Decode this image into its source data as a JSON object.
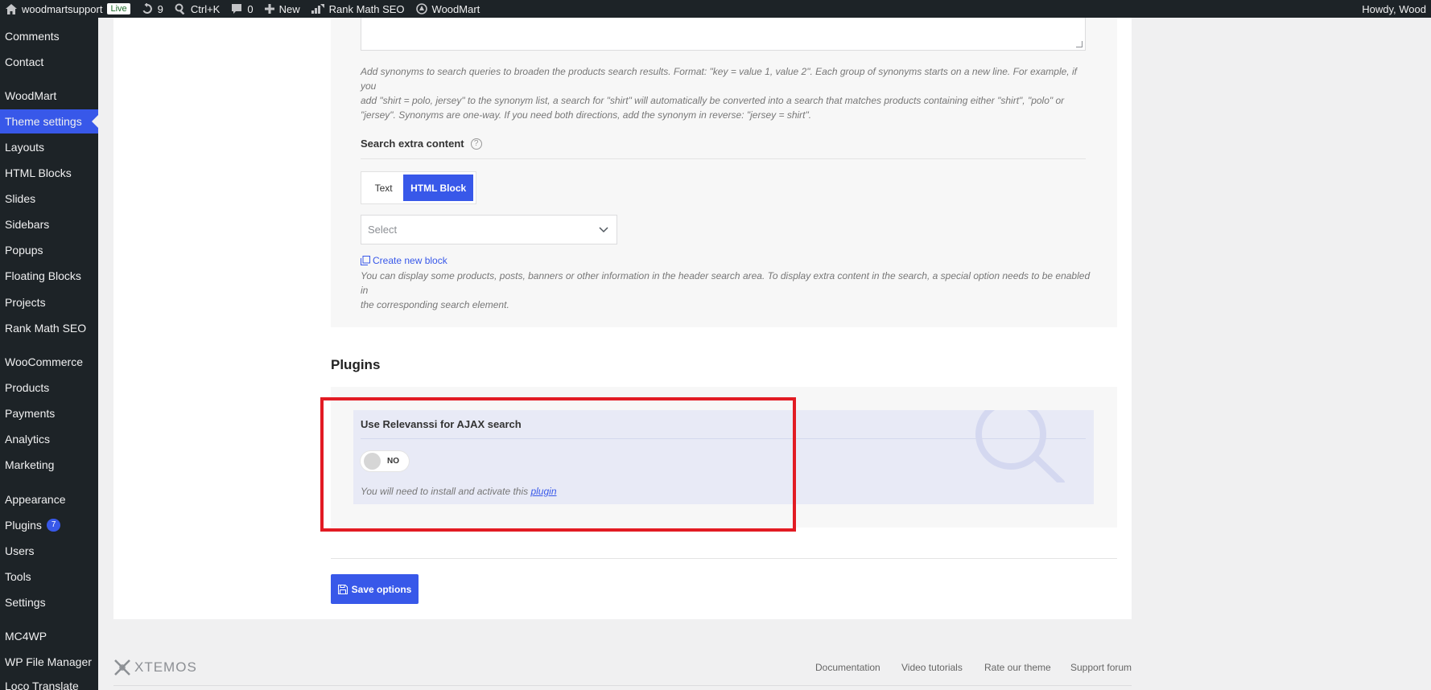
{
  "adminbar": {
    "site_name": "woodmartsupport",
    "live_badge": "Live",
    "updates_count": "9",
    "search_shortcut": "Ctrl+K",
    "comments_count": "0",
    "new_label": "New",
    "rankmath_label": "Rank Math SEO",
    "woodmart_label": "WoodMart",
    "howdy": "Howdy, Wood"
  },
  "sidebar": {
    "items": [
      {
        "label": "Comments"
      },
      {
        "label": "Contact"
      },
      {
        "label": "WoodMart"
      },
      {
        "label": "Theme settings"
      },
      {
        "label": "Layouts"
      },
      {
        "label": "HTML Blocks"
      },
      {
        "label": "Slides"
      },
      {
        "label": "Sidebars"
      },
      {
        "label": "Popups"
      },
      {
        "label": "Floating Blocks"
      },
      {
        "label": "Projects"
      },
      {
        "label": "Rank Math SEO"
      },
      {
        "label": "WooCommerce"
      },
      {
        "label": "Products"
      },
      {
        "label": "Payments"
      },
      {
        "label": "Analytics"
      },
      {
        "label": "Marketing"
      },
      {
        "label": "Appearance"
      },
      {
        "label": "Plugins",
        "badge": "7"
      },
      {
        "label": "Users"
      },
      {
        "label": "Tools"
      },
      {
        "label": "Settings"
      },
      {
        "label": "MC4WP"
      },
      {
        "label": "WP File Manager"
      },
      {
        "label": "Loco Translate"
      }
    ]
  },
  "synonyms": {
    "description_line1": "Add synonyms to search queries to broaden the products search results. Format: \"key = value 1, value 2\". Each group of synonyms starts on a new line. For example, if you",
    "description_line2": "add \"shirt = polo, jersey\" to the synonym list, a search for \"shirt\" will automatically be converted into a search that matches products containing either \"shirt\", \"polo\" or",
    "description_line3": "\"jersey\". Synonyms are one-way. If you need both directions, add the synonym in reverse: \"jersey = shirt\"."
  },
  "extra_content": {
    "title": "Search extra content",
    "help": "?",
    "option_text": "Text",
    "option_html": "HTML Block",
    "select_placeholder": "Select",
    "create_link": "Create new block",
    "description_line1": "You can display some products, posts, banners or other information in the header search area. To display extra content in the search, a special option needs to be enabled in",
    "description_line2": "the corresponding search element."
  },
  "plugins": {
    "heading": "Plugins",
    "relevanssi_title": "Use Relevanssi for AJAX search",
    "toggle_state": "NO",
    "note_prefix": "You will need to install and activate this ",
    "note_link": "plugin"
  },
  "save_button": "Save options",
  "footer": {
    "logo": "XTEMOS",
    "links": [
      "Documentation",
      "Video tutorials",
      "Rate our theme",
      "Support forum"
    ]
  },
  "colors": {
    "accent": "#3858e9",
    "highlight": "#e21b23",
    "adminbar_bg": "#1d2327"
  }
}
